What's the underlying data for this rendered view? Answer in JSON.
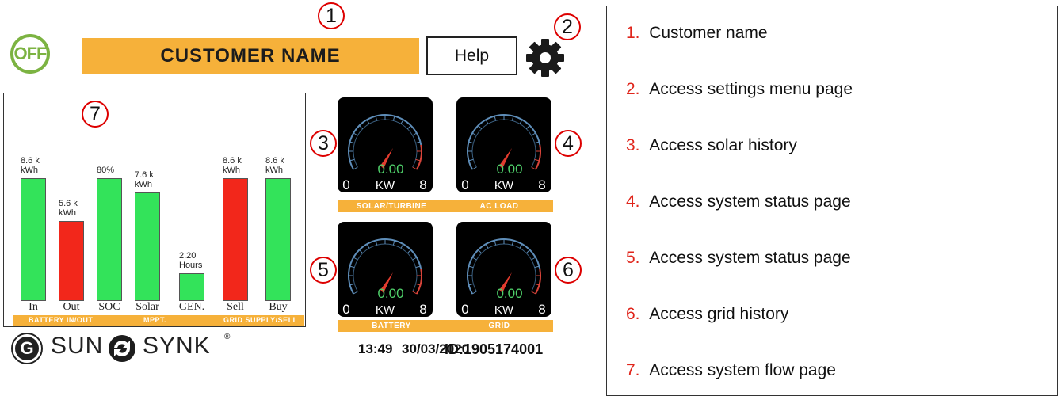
{
  "header": {
    "power_label": "OFF",
    "customer_name": "CUSTOMER NAME",
    "help_label": "Help",
    "settings_icon": "gear-icon"
  },
  "callouts": [
    "1",
    "2",
    "3",
    "4",
    "5",
    "6",
    "7"
  ],
  "chart_data": {
    "type": "bar",
    "categories": [
      "In",
      "Out",
      "SOC",
      "Solar",
      "GEN.",
      "Sell",
      "Buy"
    ],
    "values": [
      8.6,
      5.6,
      80,
      7.6,
      2.2,
      8.6,
      8.6
    ],
    "data_labels": [
      [
        "8.6 k",
        "kWh"
      ],
      [
        "5.6 k",
        "kWh"
      ],
      [
        "80%"
      ],
      [
        "7.6 k",
        "kWh"
      ],
      [
        "2.20",
        "Hours"
      ],
      [
        "8.6 k",
        "kWh"
      ],
      [
        "8.6 k",
        "kWh"
      ]
    ],
    "bar_colors": [
      "#33e35a",
      "#f2271b",
      "#33e35a",
      "#33e35a",
      "#33e35a",
      "#f2271b",
      "#33e35a"
    ],
    "group_labels": [
      "BATTERY IN/OUT",
      "MPPT.",
      "GRID SUPPLY/SELL"
    ]
  },
  "gauges": [
    {
      "value": "0.00",
      "min": "0",
      "unit": "KW",
      "max": "8",
      "label": "SOLAR/TURBINE"
    },
    {
      "value": "0.00",
      "min": "0",
      "unit": "KW",
      "max": "8",
      "label": "AC LOAD"
    },
    {
      "value": "0.00",
      "min": "0",
      "unit": "KW",
      "max": "8",
      "label": "BATTERY"
    },
    {
      "value": "0.00",
      "min": "0",
      "unit": "KW",
      "max": "8",
      "label": "GRID"
    }
  ],
  "footer": {
    "brand_g": "G",
    "brand_left": "SUN",
    "brand_right": "SYNK",
    "brand_mark": "®",
    "time": "13:49",
    "date": "30/03/2020",
    "id": "ID:1905174001"
  },
  "legend": [
    {
      "num": "1.",
      "text": "Customer name"
    },
    {
      "num": "2.",
      "text": "Access settings menu page"
    },
    {
      "num": "3.",
      "text": "Access solar history"
    },
    {
      "num": "4.",
      "text": "Access system status page"
    },
    {
      "num": "5.",
      "text": "Access system status page"
    },
    {
      "num": "6.",
      "text": "Access grid history"
    },
    {
      "num": "7.",
      "text": "Access system flow page"
    }
  ],
  "colors": {
    "accent_orange": "#f6b13a",
    "on_green": "#7cb342",
    "bar_green": "#33e35a",
    "bar_red": "#f2271b",
    "callout_red": "#e0251b"
  }
}
